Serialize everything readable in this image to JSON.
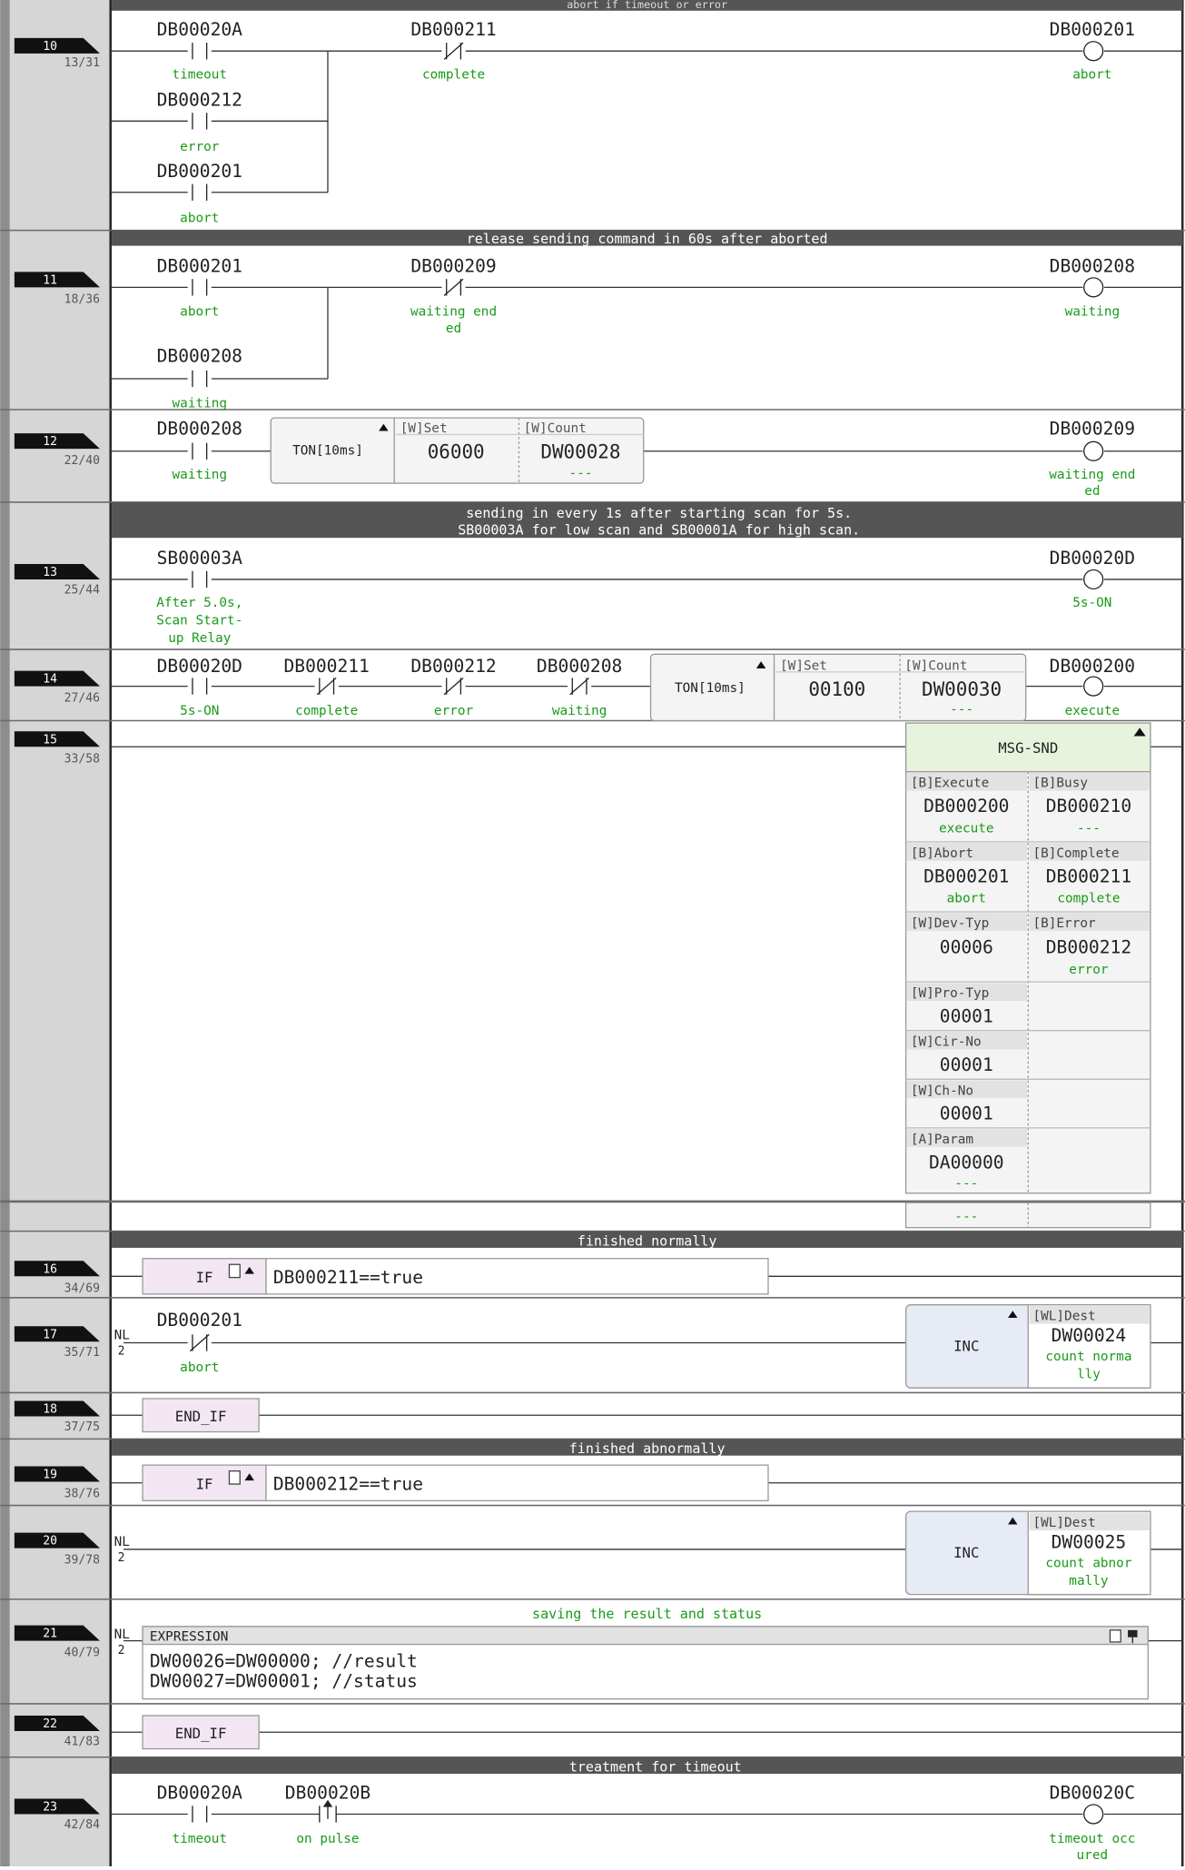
{
  "colors": {
    "rung_bg": "#d6d6d6",
    "rail": "#2a2a2a",
    "comment_bar": "#555555",
    "green_text": "#1a9a1a",
    "fb_header": "#e8f3de",
    "box_fill": "#f4f4f4",
    "if_fill": "#f3e6f3",
    "inc_fill": "#e7ebf5"
  },
  "top_comment": "abort if timeout or error",
  "rungs": [
    {
      "num": "10",
      "step": "13/31"
    },
    {
      "num": "11",
      "step": "18/36"
    },
    {
      "num": "12",
      "step": "22/40"
    },
    {
      "num": "13",
      "step": "25/44"
    },
    {
      "num": "14",
      "step": "27/46"
    },
    {
      "num": "15",
      "step": "33/58"
    },
    {
      "num": "16",
      "step": "34/69"
    },
    {
      "num": "17",
      "step": "35/71"
    },
    {
      "num": "18",
      "step": "37/75"
    },
    {
      "num": "19",
      "step": "38/76"
    },
    {
      "num": "20",
      "step": "39/78"
    },
    {
      "num": "21",
      "step": "40/79"
    },
    {
      "num": "22",
      "step": "41/83"
    },
    {
      "num": "23",
      "step": "42/84"
    }
  ],
  "comments": {
    "c11": "release sending command in 60s after aborted",
    "c13_l1": "sending in every 1s after starting scan for 5s.",
    "c13_l2": "SB00003A for low scan and SB00001A for high scan.",
    "c16": "finished normally",
    "c19": "finished abnormally",
    "c21": "saving the result and status",
    "c23": "treatment for timeout"
  },
  "r10": {
    "c1": "DB00020A",
    "c1l": "timeout",
    "c2": "DB000212",
    "c2l": "error",
    "c3": "DB000201",
    "c3l": "abort",
    "c4": "DB000211",
    "c4l": "complete",
    "coil": "DB000201",
    "coill": "abort"
  },
  "r11": {
    "c1": "DB000201",
    "c1l": "abort",
    "c2": "DB000208",
    "c2l": "waiting",
    "c3": "DB000209",
    "c3l1": "waiting end",
    "c3l2": "ed",
    "coil": "DB000208",
    "coill": "waiting"
  },
  "r12": {
    "c1": "DB000208",
    "c1l": "waiting",
    "ton": "TON[10ms]",
    "set_h": "[W]Set",
    "set_v": "06000",
    "cnt_h": "[W]Count",
    "cnt_v": "DW00028",
    "cnt_l": "---",
    "coil": "DB000209",
    "coill1": "waiting end",
    "coill2": "ed"
  },
  "r13": {
    "c1": "SB00003A",
    "c1l1": "After 5.0s,",
    "c1l2": "Scan Start-",
    "c1l3": "up Relay",
    "coil": "DB00020D",
    "coill": "5s-ON"
  },
  "r14": {
    "c1": "DB00020D",
    "c1l": "5s-ON",
    "c2": "DB000211",
    "c2l": "complete",
    "c3": "DB000212",
    "c3l": "error",
    "c4": "DB000208",
    "c4l": "waiting",
    "ton": "TON[10ms]",
    "set_h": "[W]Set",
    "set_v": "00100",
    "cnt_h": "[W]Count",
    "cnt_v": "DW00030",
    "cnt_l": "---",
    "coil": "DB000200",
    "coill": "execute"
  },
  "fb": {
    "title": "MSG-SND",
    "l1h": "[B]Execute",
    "l1v": "DB000200",
    "l1l": "execute",
    "r1h": "[B]Busy",
    "r1v": "DB000210",
    "r1l": "---",
    "l2h": "[B]Abort",
    "l2v": "DB000201",
    "l2l": "abort",
    "r2h": "[B]Complete",
    "r2v": "DB000211",
    "r2l": "complete",
    "l3h": "[W]Dev-Typ",
    "l3v": "00006",
    "r3h": "[B]Error",
    "r3v": "DB000212",
    "r3l": "error",
    "l4h": "[W]Pro-Typ",
    "l4v": "00001",
    "l5h": "[W]Cir-No",
    "l5v": "00001",
    "l6h": "[W]Ch-No",
    "l6v": "00001",
    "l7h": "[A]Param",
    "l7v": "DA00000",
    "l7l": "---",
    "extra": "---"
  },
  "r16": {
    "kw": "IF",
    "expr": "DB000211==true"
  },
  "r17": {
    "nl": "NL",
    "nl2": "2",
    "c1": "DB000201",
    "c1l": "abort",
    "inc": "INC",
    "dh": "[WL]Dest",
    "dv": "DW00024",
    "dl1": "count norma",
    "dl2": "lly"
  },
  "r18": {
    "kw": "END_IF"
  },
  "r19": {
    "kw": "IF",
    "expr": "DB000212==true"
  },
  "r20": {
    "nl": "NL",
    "nl2": "2",
    "inc": "INC",
    "dh": "[WL]Dest",
    "dv": "DW00025",
    "dl1": "count abnor",
    "dl2": "mally"
  },
  "r21": {
    "nl": "NL",
    "nl2": "2",
    "hdr": "EXPRESSION",
    "line1": "DW00026=DW00000; //result",
    "line2": "DW00027=DW00001; //status"
  },
  "r22": {
    "kw": "END_IF"
  },
  "r23": {
    "c1": "DB00020A",
    "c1l": "timeout",
    "c2": "DB00020B",
    "c2l": "on pulse",
    "coil": "DB00020C",
    "coill1": "timeout occ",
    "coill2": "ured"
  }
}
